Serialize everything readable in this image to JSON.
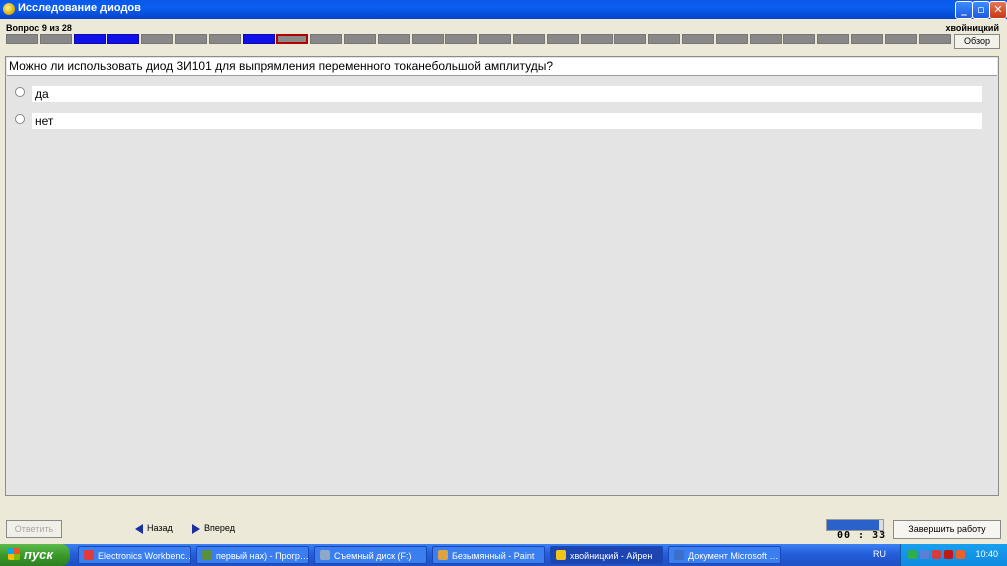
{
  "window": {
    "title": "Исследование диодов"
  },
  "header": {
    "question_counter": "Вопрос 9 из 28",
    "user": "хвойницкий",
    "review_label": "Обзор",
    "progress": {
      "total": 28,
      "current": 9,
      "answered": [
        3,
        4,
        8
      ],
      "colors": {
        "answered": "#1010e8",
        "unanswered": "#888888",
        "current_border": "#b00000"
      }
    }
  },
  "question": {
    "text": "Можно ли использовать диод 3И101 для выпрямления переменного токанебольшой амплитуды?",
    "answers": [
      "да",
      "нет"
    ]
  },
  "bottom": {
    "answer_label": "Ответить",
    "back_label": "Назад",
    "forward_label": "Вперед",
    "timer": "00 : 33",
    "finish_label": "Завершить работу"
  },
  "taskbar": {
    "start_label": "пуск",
    "tasks": [
      {
        "label": "Electronics Workbenc…",
        "icon": "electronics-workbench-icon",
        "active": false
      },
      {
        "label": "первый нах) - Прогр…",
        "icon": "image-viewer-icon",
        "active": false
      },
      {
        "label": "Съемный диск (F:)",
        "icon": "drive-icon",
        "active": false
      },
      {
        "label": "Безымянный - Paint",
        "icon": "paint-icon",
        "active": false
      },
      {
        "label": "хвойницкий - Айрен",
        "icon": "test-app-icon",
        "active": true
      },
      {
        "label": "Документ Microsoft …",
        "icon": "word-document-icon",
        "active": false
      }
    ],
    "language": "RU",
    "clock": "10:40"
  }
}
